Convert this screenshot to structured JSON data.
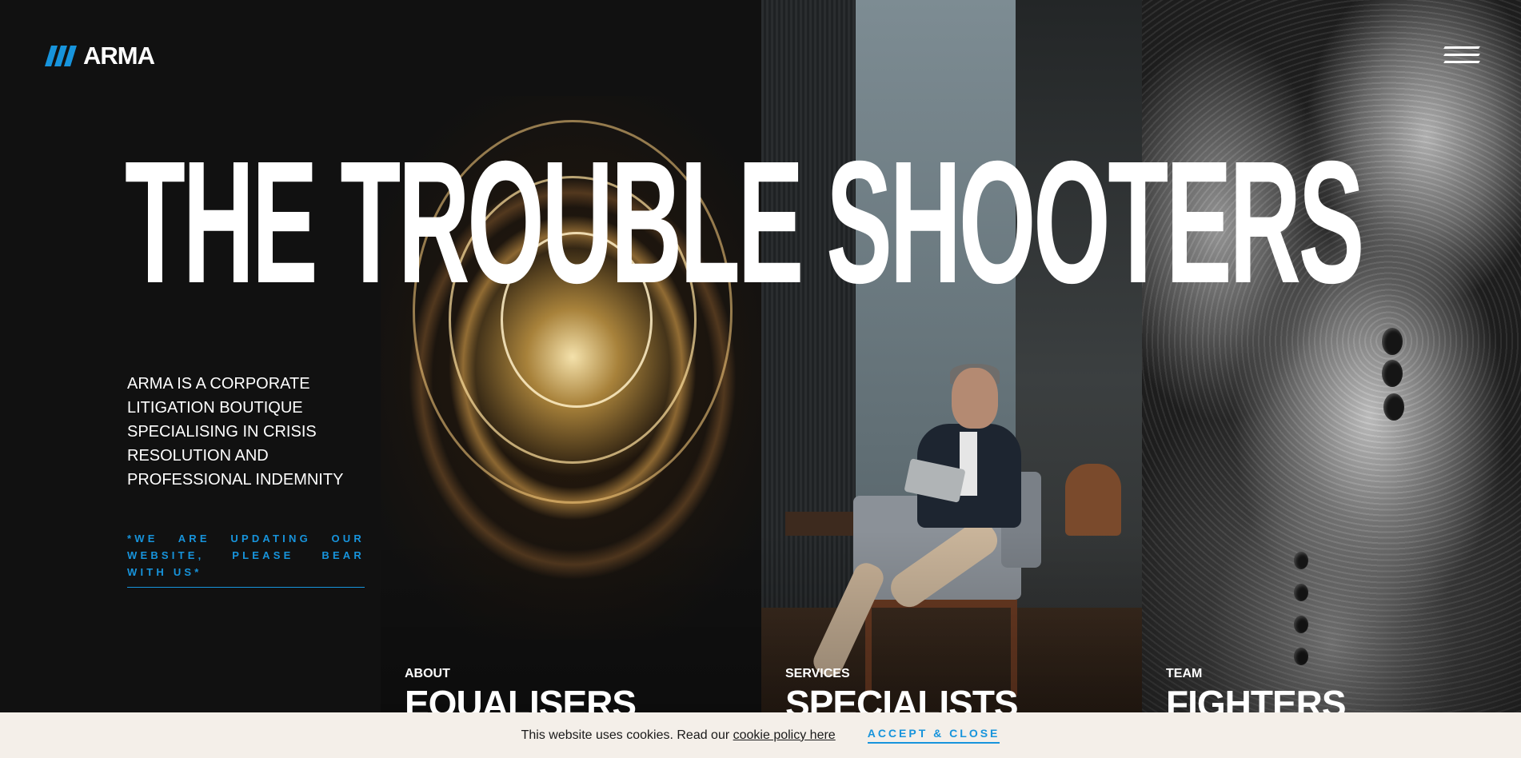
{
  "brand": {
    "name": "ARMA",
    "accent_color": "#1794dc",
    "logo_icon": "arma-slash-logo-icon"
  },
  "header": {
    "menu_icon": "hamburger-menu-icon"
  },
  "hero": {
    "title": "THE TROUBLE SHOOTERS",
    "intro": "ARMA IS A CORPORATE LITIGATION BOUTIQUE SPECIALISING IN CRISIS RESOLUTION AND PROFESSIONAL INDEMNITY",
    "notice": "*WE ARE UPDATING OUR WEBSITE, PLEASE BEAR WITH US*"
  },
  "sections": [
    {
      "label": "ABOUT",
      "heading": "EQUALISERS",
      "image": "light-bulb-filament-photo"
    },
    {
      "label": "SERVICES",
      "heading": "SPECIALISTS",
      "image": "man-with-tablet-on-sofa-photo"
    },
    {
      "label": "TEAM",
      "heading": "FIGHTERS",
      "image": "engraved-armor-photo"
    }
  ],
  "cookie": {
    "text": "This website uses cookies. Read our ",
    "link": "cookie policy here",
    "accept": "ACCEPT & CLOSE",
    "background": "#f4efe9"
  }
}
